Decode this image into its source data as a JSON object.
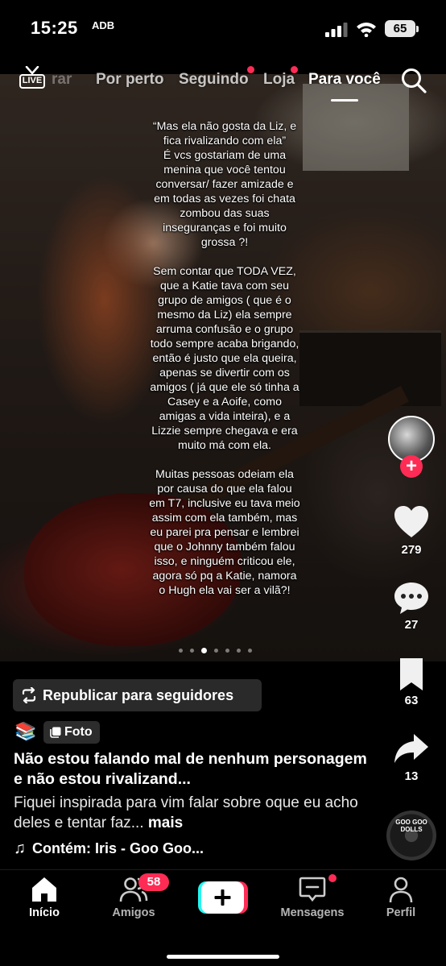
{
  "status_bar": {
    "time": "15:25",
    "extra": "ADB",
    "battery": "65"
  },
  "top_nav": {
    "live_label": "LIVE",
    "faded_tab": "rar",
    "tabs": [
      {
        "label": "Por perto",
        "active": false,
        "dot": false
      },
      {
        "label": "Seguindo",
        "active": false,
        "dot": true
      },
      {
        "label": "Loja",
        "active": false,
        "dot": true
      },
      {
        "label": "Para você",
        "active": true,
        "dot": false
      }
    ],
    "accent_color": "#fe2c55"
  },
  "post": {
    "caption": "“Mas ela não gosta da Liz, e fica rivalizando com ela”\nÉ vcs gostariam de uma menina que você tentou conversar/ fazer amizade e em todas as vezes foi chata zombou das suas inseguranças e foi muito grossa ?!\n\nSem contar que TODA VEZ, que a Katie tava com seu grupo de amigos ( que é o mesmo da Liz) ela sempre arruma confusão e o grupo todo sempre acaba brigando, então é justo que ela queira, apenas se divertir com os amigos ( já que ele só tinha a Casey e a Aoife, como amigas a vida inteira), e a Lizzie sempre chegava e era muito má com ela.\n\nMuitas pessoas odeiam ela por causa do que ela falou em T7, inclusive eu tava meio assim com ela também, mas eu parei pra pensar e lembrei que o Johnny também falou isso, e ninguém criticou ele, agora só pq a Katie, namora o Hugh ela vai ser a vilã?!",
    "carousel": {
      "total": 7,
      "active_index": 2
    },
    "repost_label": "Republicar para seguidores",
    "emoji": "📚",
    "badge_label": "Foto",
    "title": "Não estou falando mal de nenhum personagem e não estou rivalizand...",
    "description": "Fiquei inspirada para vim falar sobre oque eu acho deles e tentar faz...",
    "more_label": "mais",
    "music": "Contém: Iris - Goo Goo..."
  },
  "actions": {
    "likes": "279",
    "comments": "27",
    "saves": "63",
    "shares": "13",
    "avatar_plus": "+",
    "disc_label": "GOO GOO DOLLS"
  },
  "bottom_nav": {
    "items": [
      {
        "label": "Início",
        "icon": "home-icon",
        "active": true
      },
      {
        "label": "Amigos",
        "icon": "friends-icon",
        "active": false,
        "badge": "58"
      },
      {
        "label": "",
        "icon": "create-icon",
        "active": false
      },
      {
        "label": "Mensagens",
        "icon": "inbox-icon",
        "active": false,
        "dot": true
      },
      {
        "label": "Perfil",
        "icon": "profile-icon",
        "active": false
      }
    ]
  }
}
